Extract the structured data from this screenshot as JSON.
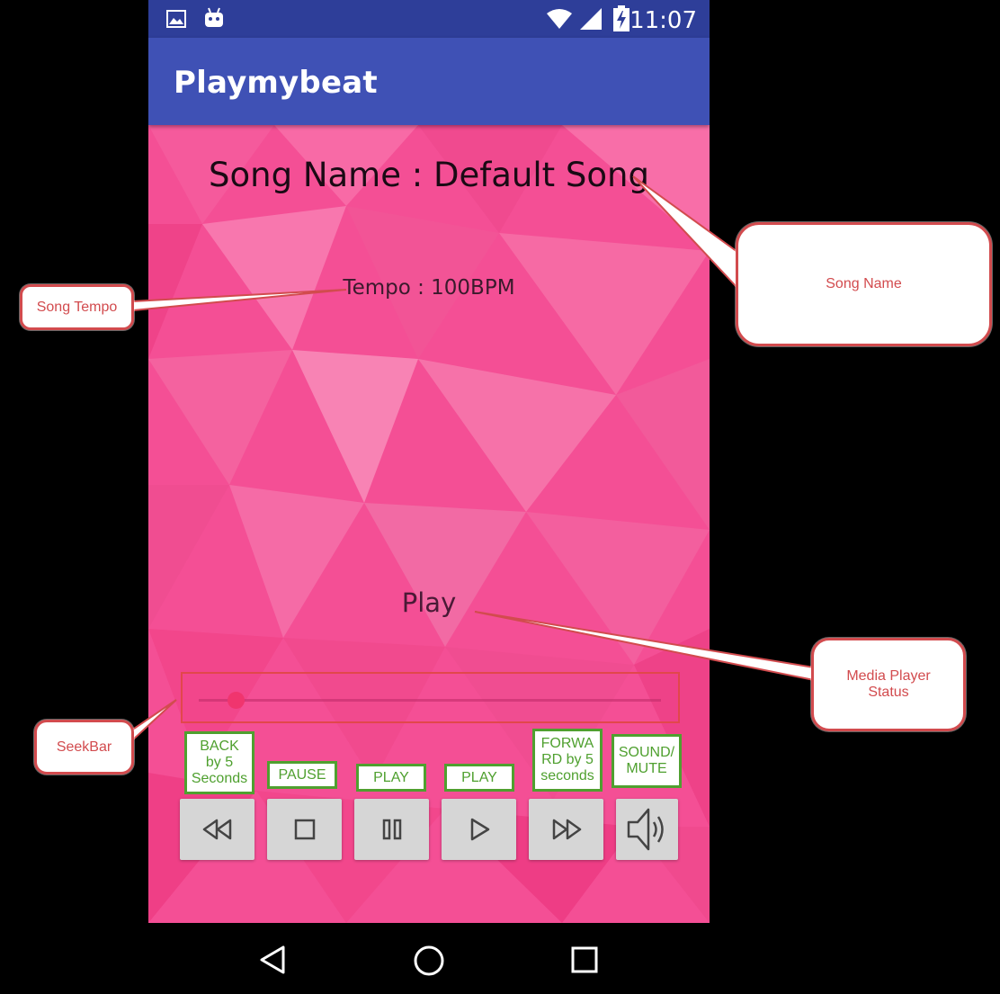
{
  "status_bar": {
    "time": "11:07",
    "left_icons": [
      "image-icon",
      "android-icon"
    ],
    "right_icons": [
      "wifi-icon",
      "signal-icon",
      "battery-charging-icon"
    ]
  },
  "app": {
    "title": "Playmybeat",
    "toolbar_color": "#3f51b5"
  },
  "main": {
    "song_name": "Song Name : Default Song",
    "tempo": "Tempo : 100BPM",
    "player_status": "Play",
    "seekbar_progress": 0.08,
    "background_color": "#f44f95"
  },
  "controls": [
    {
      "name": "rewind-button",
      "icon": "rewind-icon",
      "label": "BACK\nby 5\nSeconds"
    },
    {
      "name": "stop-button",
      "icon": "stop-icon",
      "label": "PAUSE"
    },
    {
      "name": "pause-button",
      "icon": "pause-icon",
      "label": "PLAY"
    },
    {
      "name": "play-button",
      "icon": "play-icon",
      "label": "PLAY"
    },
    {
      "name": "fast-forward-button",
      "icon": "fast-forward-icon",
      "label": "FORWA\nRD by 5\nseconds"
    },
    {
      "name": "sound-mute-button",
      "icon": "speaker-icon",
      "label": "SOUND/\nMUTE"
    }
  ],
  "callouts": {
    "song_name": "Song Name",
    "song_tempo": "Song Tempo",
    "media_player_status": "Media Player\nStatus",
    "seekbar": "SeekBar"
  },
  "nav_bar": {
    "buttons": [
      "back-icon",
      "home-icon",
      "recents-icon"
    ]
  },
  "colors": {
    "callout_red": "#d24b4e",
    "label_green": "#4fa02f"
  }
}
